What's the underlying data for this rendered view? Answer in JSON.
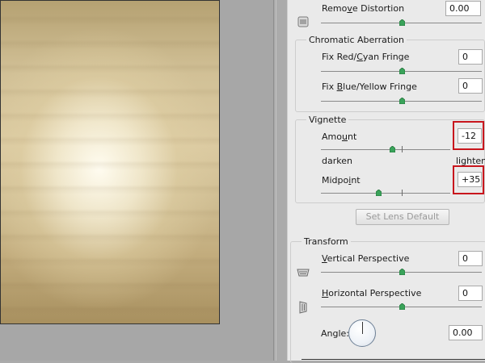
{
  "remove_distortion": {
    "label": "Remove Distortion",
    "mnemonic": "v",
    "value": "0.00"
  },
  "chromatic_aberration": {
    "title": "Chromatic Aberration",
    "fix_red_cyan": {
      "label": "Fix Red/Cyan Fringe",
      "value": "0"
    },
    "fix_blue_yellow": {
      "label": "Fix Blue/Yellow Fringe",
      "value": "0"
    }
  },
  "vignette": {
    "title": "Vignette",
    "amount": {
      "label": "Amount",
      "value": "-12"
    },
    "darken_label": "darken",
    "lighten_label": "lighten",
    "midpoint": {
      "label": "Midpoint",
      "value": "+35"
    }
  },
  "set_lens_default_label": "Set Lens Default",
  "transform": {
    "title": "Transform",
    "vertical_perspective": {
      "label": "Vertical Perspective",
      "value": "0"
    },
    "horizontal_perspective": {
      "label": "Horizontal Perspective",
      "value": "0"
    },
    "angle": {
      "label": "Angle:",
      "value": "0.00"
    }
  },
  "colors": {
    "highlight": "#c8161d",
    "slider_thumb": "#3aa35a"
  }
}
